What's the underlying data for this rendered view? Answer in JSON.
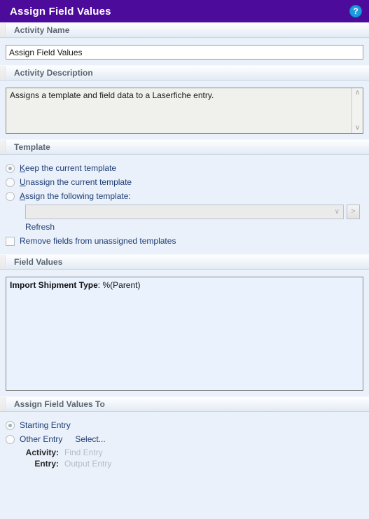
{
  "titlebar": {
    "title": "Assign Field Values",
    "help_icon": "help-question-icon",
    "help_glyph": "?",
    "background": "#4d0b9c"
  },
  "sections": {
    "activity_name": {
      "header": "Activity Name",
      "value": "Assign Field Values",
      "placeholder": ""
    },
    "activity_description": {
      "header": "Activity Description",
      "value": "Assigns a template and field data to a Laserfiche entry.",
      "scroll_up_glyph": "∧",
      "scroll_down_glyph": "∨"
    },
    "template": {
      "header": "Template",
      "options": [
        {
          "label_pre": "",
          "accel": "K",
          "label_post": "eep the current template",
          "selected": true
        },
        {
          "label_pre": "",
          "accel": "U",
          "label_post": "nassign the current template",
          "selected": false
        },
        {
          "label_pre": "",
          "accel": "A",
          "label_post": "ssign the following template:",
          "selected": false
        }
      ],
      "combo_value": "",
      "combo_chevron": "∨",
      "arrow_button_label": ">",
      "refresh_label": "Refresh",
      "checkbox": {
        "label": "Remove fields from unassigned templates",
        "checked": false
      }
    },
    "field_values": {
      "header": "Field Values",
      "items": [
        {
          "name": "Import Shipment Type",
          "separator": ": ",
          "value": "%(Parent)"
        }
      ]
    },
    "assign_to": {
      "header": "Assign Field Values To",
      "options": [
        {
          "label": "Starting Entry",
          "selected": true
        },
        {
          "label": "Other Entry",
          "selected": false
        }
      ],
      "select_link": "Select...",
      "details": [
        {
          "key": "Activity:",
          "value": "Find Entry"
        },
        {
          "key": "Entry:",
          "value": "Output Entry"
        }
      ]
    }
  },
  "colors": {
    "title_purple": "#4d0b9c",
    "page_background": "#eaf1fb",
    "link_blue": "#1f3d73",
    "header_text": "#5c6670",
    "disabled_text": "#b6bcc4"
  }
}
